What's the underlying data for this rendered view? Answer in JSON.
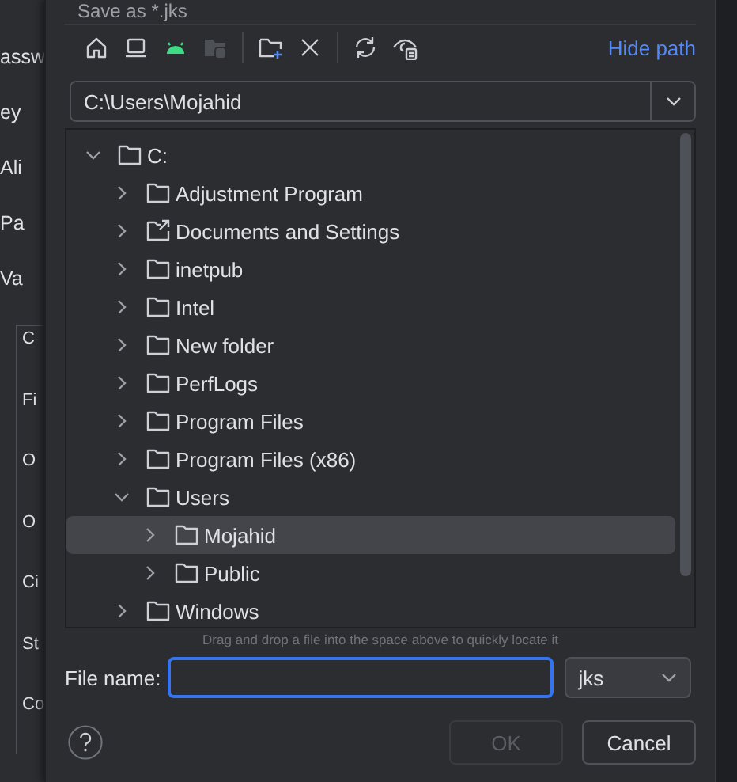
{
  "background_labels": [
    "assw",
    "ey",
    "Ali",
    "Pa",
    "Va",
    "C",
    "Fi",
    "O",
    "O",
    "Ci",
    "St",
    "Co"
  ],
  "dialog": {
    "title": "Save as *.jks",
    "toolbar": [
      {
        "disabled": false
      },
      {
        "disabled": false
      },
      {
        "disabled": false
      },
      {
        "disabled": true
      },
      {
        "disabled": false
      },
      {
        "disabled": false
      },
      {
        "disabled": false
      },
      {
        "disabled": false
      }
    ],
    "hide_path": "Hide path",
    "path": "C:\\Users\\Mojahid",
    "tree": [
      {
        "label": "C:",
        "kind": "drive",
        "expanded": true,
        "selected": false,
        "children": [
          {
            "label": "Adjustment Program",
            "kind": "folder",
            "expanded": false,
            "selected": false
          },
          {
            "label": "Documents and Settings",
            "kind": "shortcut",
            "expanded": false,
            "selected": false
          },
          {
            "label": "inetpub",
            "kind": "folder",
            "expanded": false,
            "selected": false
          },
          {
            "label": "Intel",
            "kind": "folder",
            "expanded": false,
            "selected": false
          },
          {
            "label": "New folder",
            "kind": "folder",
            "expanded": false,
            "selected": false
          },
          {
            "label": "PerfLogs",
            "kind": "folder",
            "expanded": false,
            "selected": false
          },
          {
            "label": "Program Files",
            "kind": "folder",
            "expanded": false,
            "selected": false
          },
          {
            "label": "Program Files (x86)",
            "kind": "folder",
            "expanded": false,
            "selected": false
          },
          {
            "label": "Users",
            "kind": "folder",
            "expanded": true,
            "selected": false,
            "children": [
              {
                "label": "Mojahid",
                "kind": "folder",
                "expanded": false,
                "selected": true
              },
              {
                "label": "Public",
                "kind": "folder",
                "expanded": false,
                "selected": false
              }
            ]
          },
          {
            "label": "Windows",
            "kind": "folder",
            "expanded": false,
            "selected": false
          }
        ]
      }
    ],
    "hint": "Drag and drop a file into the space above to quickly locate it",
    "file_name_label": "File name:",
    "file_type": "jks",
    "buttons": [
      {
        "label": "OK",
        "disabled": true
      },
      {
        "label": "Cancel",
        "disabled": false
      }
    ]
  }
}
